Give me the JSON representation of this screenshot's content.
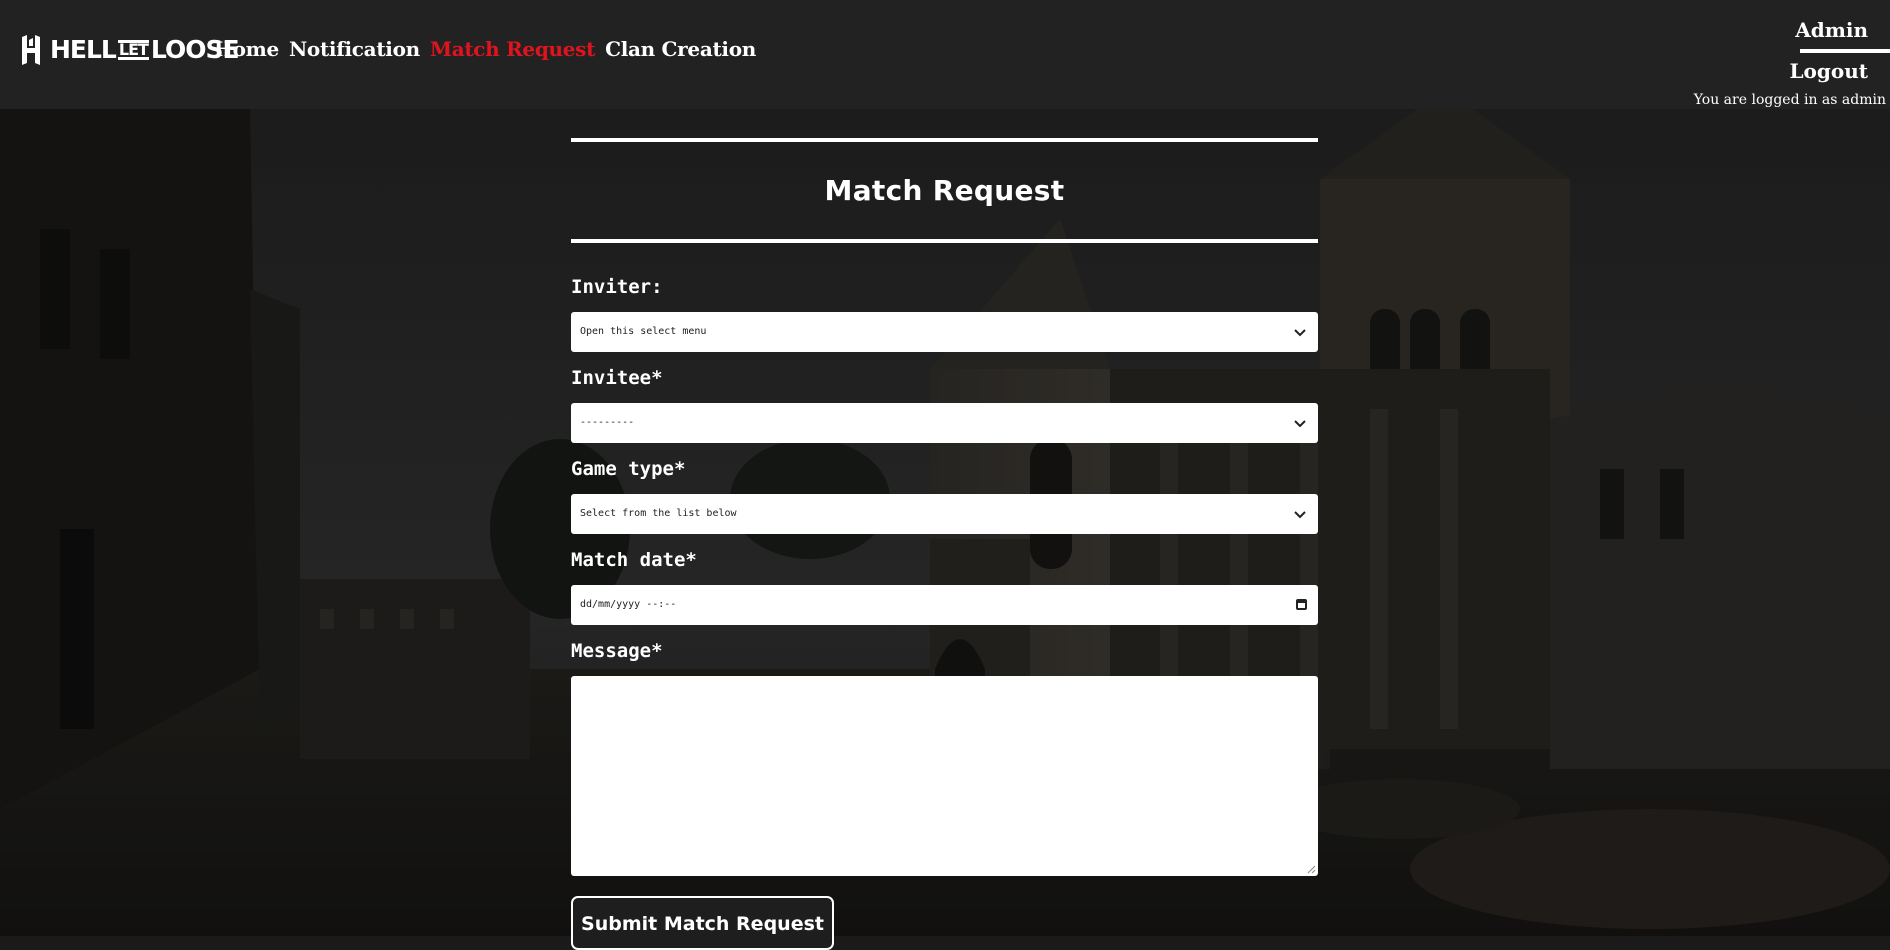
{
  "brand": {
    "logo_text_a": "HELL",
    "logo_text_b": "LET",
    "logo_text_c": "LOOSE"
  },
  "nav": {
    "items": [
      {
        "label": "Home",
        "active": false
      },
      {
        "label": "Notification",
        "active": false
      },
      {
        "label": "Match Request",
        "active": true
      },
      {
        "label": "Clan Creation",
        "active": false
      }
    ]
  },
  "user": {
    "name_label": "Admin",
    "logout_label": "Logout",
    "status_text": "You are logged in as admin"
  },
  "form": {
    "title": "Match Request",
    "inviter": {
      "label": "Inviter:",
      "value": "Open this select menu"
    },
    "invitee": {
      "label": "Invitee*",
      "value": "---------"
    },
    "game_type": {
      "label": "Game type*",
      "value": "Select from the list below"
    },
    "match_date": {
      "label": "Match date*",
      "value": "dd/mm/yyyy --:--"
    },
    "message": {
      "label": "Message*",
      "value": ""
    },
    "submit_label": "Submit Match Request"
  },
  "colors": {
    "navbar_bg": "#222222",
    "active_link": "#e0141e",
    "text": "#ffffff"
  },
  "icons": {
    "logo": "hll-logo-icon",
    "select_arrow": "chevron-down-icon",
    "date_picker": "calendar-icon"
  }
}
